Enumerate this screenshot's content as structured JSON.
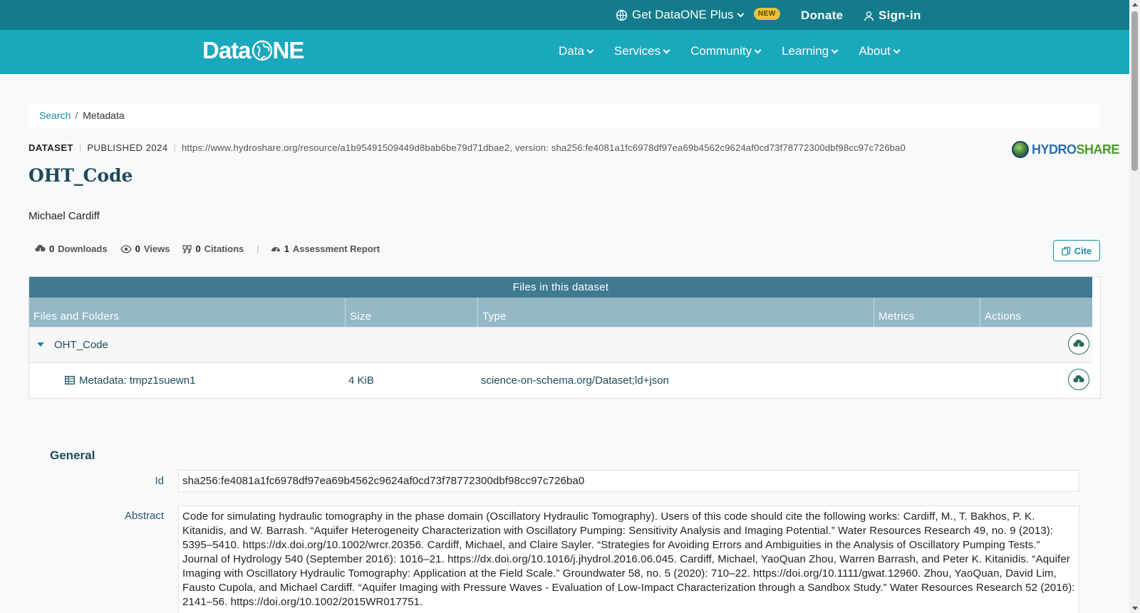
{
  "topbar": {
    "plus_label": "Get DataONE Plus",
    "new_badge": "NEW",
    "donate_label": "Donate",
    "signin_label": "Sign-in"
  },
  "navbar": {
    "logo_text_left": "Data",
    "logo_text_right": "NE",
    "items": [
      {
        "label": "Data"
      },
      {
        "label": "Services"
      },
      {
        "label": "Community"
      },
      {
        "label": "Learning"
      },
      {
        "label": "About"
      }
    ]
  },
  "breadcrumb": {
    "search_label": "Search",
    "separator": "/",
    "current": "Metadata"
  },
  "dataset": {
    "type_label": "DATASET",
    "published_label": "PUBLISHED 2024",
    "identifier": "https://www.hydroshare.org/resource/a1b95491509449d8bab6be79d71dbae2, version: sha256:fe4081a1fc6978df97ea69b4562c9624af0cd73f78772300dbf98cc97c726ba0",
    "repository_logo_left": "HYDRO",
    "repository_logo_right": "SHARE",
    "title": "OHT_Code",
    "author": "Michael Cardiff"
  },
  "stats": {
    "downloads_count": "0",
    "downloads_label": "Downloads",
    "views_count": "0",
    "views_label": "Views",
    "citations_count": "0",
    "citations_label": "Citations",
    "assessment_count": "1",
    "assessment_label": "Assessment Report",
    "cite_label": "Cite"
  },
  "files_table": {
    "caption": "Files in this dataset",
    "columns": [
      "Files and Folders",
      "Size",
      "Type",
      "Metrics",
      "Actions"
    ],
    "rows": [
      {
        "name": "OHT_Code",
        "size": "",
        "type": ""
      },
      {
        "name": "Metadata: tmpz1suewn1",
        "size": "4 KiB",
        "type": "science-on-schema.org/Dataset;ld+json"
      }
    ]
  },
  "general": {
    "heading": "General",
    "id_label": "Id",
    "id_value": "sha256:fe4081a1fc6978df97ea69b4562c9624af0cd73f78772300dbf98cc97c726ba0",
    "abstract_label": "Abstract",
    "abstract_value": "Code for simulating hydraulic tomography in the phase domain (Oscillatory Hydraulic Tomography). Users of this code should cite the following works: Cardiff, M., T. Bakhos, P. K. Kitanidis, and W. Barrash. “Aquifer Heterogeneity Characterization with Oscillatory Pumping: Sensitivity Analysis and Imaging Potential.” Water Resources Research 49, no. 9 (2013): 5395–5410. https://dx.doi.org/10.1002/wrcr.20356. Cardiff, Michael, and Claire Sayler. “Strategies for Avoiding Errors and Ambiguities in the Analysis of Oscillatory Pumping Tests.” Journal of Hydrology 540 (September 2016): 1016–21. https://dx.doi.org/10.1016/j.jhydrol.2016.06.045. Cardiff, Michael, YaoQuan Zhou, Warren Barrash, and Peter K. Kitanidis. “Aquifer Imaging with Oscillatory Hydraulic Tomography: Application at the Field Scale.” Groundwater 58, no. 5 (2020): 710–22. https://doi.org/10.1111/gwat.12960. Zhou, YaoQuan, David Lim, Fausto Cupola, and Michael Cardiff. “Aquifer Imaging with Pressure Waves - Evaluation of Low-Impact Characterization through a Sandbox Study.” Water Resources Research 52 (2016): 2141–56. https://doi.org/10.1002/2015WR017751."
  },
  "colors": {
    "topbar": "#137b8c",
    "navbar": "#1aa8bd",
    "accent": "#1a8ea3",
    "table_header_dark": "#3f7a91",
    "table_header_light": "#94b8c6",
    "new_badge": "#e8c13c"
  }
}
